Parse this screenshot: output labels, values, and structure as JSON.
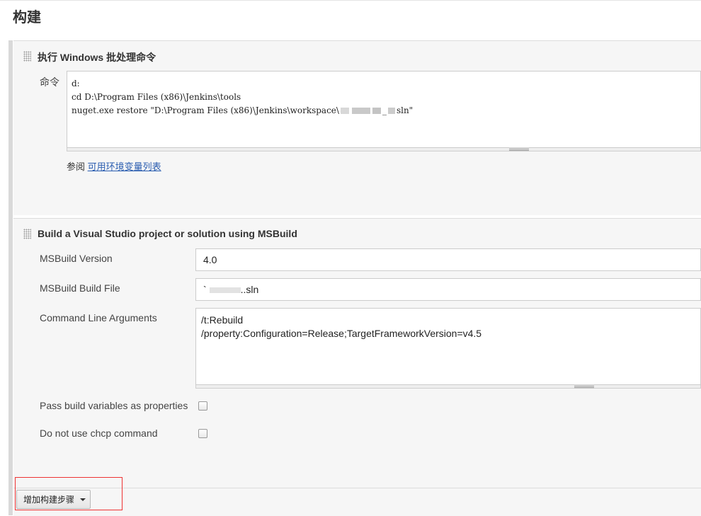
{
  "page": {
    "section_title": "构建"
  },
  "batch_step": {
    "title": "执行 Windows 批处理命令",
    "command_label": "命令",
    "command_lines": [
      "d:",
      "cd D:\\Program Files (x86)\\Jenkins\\tools",
      "nuget.exe restore \"D:\\Program Files (x86)\\Jenkins\\workspace\\",
      "_",
      "sln\""
    ],
    "help_prefix": "参阅",
    "help_link": "可用环境变量列表"
  },
  "msbuild_step": {
    "title": "Build a Visual Studio project or solution using MSBuild",
    "version_label": "MSBuild Version",
    "version_value": "4.0",
    "build_file_label": "MSBuild Build File",
    "build_file_value_prefix": "` ",
    "build_file_value_suffix": "..sln",
    "args_label": "Command Line Arguments",
    "args_lines": [
      "/t:Rebuild",
      "/property:Configuration=Release;TargetFrameworkVersion=v4.5"
    ],
    "pass_vars_label": "Pass build variables as properties",
    "pass_vars_checked": false,
    "no_chcp_label": "Do not use chcp command",
    "no_chcp_checked": false
  },
  "footer": {
    "add_step_button": "增加构建步骤"
  }
}
